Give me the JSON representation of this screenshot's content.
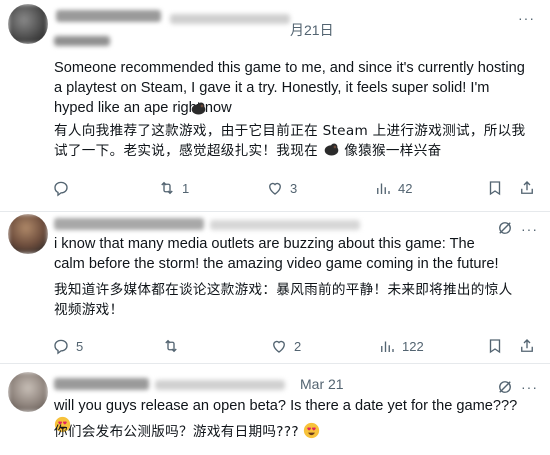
{
  "tweets": [
    {
      "date": "月21日",
      "text_en": "Someone recommended this game to me, and since it's currently hosting a playtest on Steam, I gave it a try. Honestly, it feels super solid! I'm hyped like an ape right now",
      "text_cn": "有人向我推荐了这款游戏，由于它目前正在 Steam 上进行游戏测试，所以我试了一下。老实说，感觉超级扎实！我现在",
      "text_cn_tail": "像猿猴一样兴奋",
      "replies": "",
      "reposts": "1",
      "likes": "3",
      "views": "42"
    },
    {
      "date": "",
      "text_en": "i know that many media outlets are buzzing about this game: The calm before the storm! the amazing video game coming in the future!",
      "text_cn": "我知道许多媒体都在谈论这款游戏：暴风雨前的平静！未来即将推出的惊人视频游戏！",
      "replies": "5",
      "reposts": "",
      "likes": "2",
      "views": "122"
    },
    {
      "date": "Mar 21",
      "text_en": "will you guys release an open beta? Is there a date yet for the game???",
      "text_cn": "你们会发布公测版吗？游戏有日期吗???"
    }
  ],
  "icons": {
    "more": "more-icon",
    "grok": "grok-icon",
    "reply": "reply-icon",
    "repost": "repost-icon",
    "like": "like-icon",
    "views": "views-icon",
    "bookmark": "bookmark-icon",
    "share": "share-icon",
    "gorilla": "gorilla-emoji",
    "heart_eyes": "heart-eyes-emoji"
  },
  "colors": {
    "text": "#0f1419",
    "secondary": "#536471",
    "divider": "#e6e9ec"
  }
}
